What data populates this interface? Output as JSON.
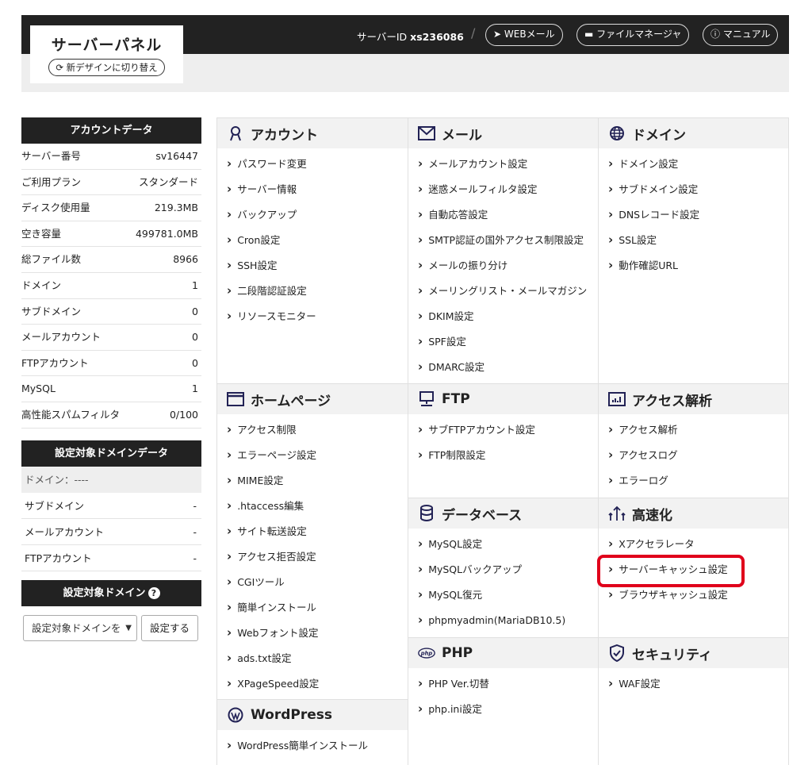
{
  "header": {
    "logo_title": "サーバーパネル",
    "redesign_label": "新デザインに切り替え",
    "server_id_label": "サーバーID",
    "server_id_value": "xs236086",
    "separator": "/",
    "buttons": {
      "webmail": "WEBメール",
      "file_manager": "ファイルマネージャ",
      "manual": "マニュアル"
    }
  },
  "account": {
    "title": "アカウントデータ",
    "rows": [
      {
        "label": "サーバー番号",
        "value": "sv16447"
      },
      {
        "label": "ご利用プラン",
        "value": "スタンダード"
      },
      {
        "label": "ディスク使用量",
        "value": "219.3MB"
      },
      {
        "label": "空き容量",
        "value": "499781.0MB"
      },
      {
        "label": "総ファイル数",
        "value": "8966"
      },
      {
        "label": "ドメイン",
        "value": "1"
      },
      {
        "label": "サブドメイン",
        "value": "0"
      },
      {
        "label": "メールアカウント",
        "value": "0"
      },
      {
        "label": "FTPアカウント",
        "value": "0"
      },
      {
        "label": "MySQL",
        "value": "1"
      },
      {
        "label": "高性能スパムフィルタ",
        "value": "0/100"
      }
    ]
  },
  "domain_data": {
    "title": "設定対象ドメインデータ",
    "domain_row": "ドメイン：----",
    "rows": [
      {
        "label": "サブドメイン",
        "value": "-"
      },
      {
        "label": "メールアカウント",
        "value": "-"
      },
      {
        "label": "FTPアカウント",
        "value": "-"
      }
    ]
  },
  "target_domain": {
    "title": "設定対象ドメイン",
    "select_value": "設定対象ドメインを",
    "apply_label": "設定する"
  },
  "sections": {
    "account": {
      "title": "アカウント",
      "links": [
        "パスワード変更",
        "サーバー情報",
        "バックアップ",
        "Cron設定",
        "SSH設定",
        "二段階認証設定",
        "リソースモニター"
      ]
    },
    "mail": {
      "title": "メール",
      "links": [
        "メールアカウント設定",
        "迷惑メールフィルタ設定",
        "自動応答設定",
        "SMTP認証の国外アクセス制限設定",
        "メールの振り分け",
        "メーリングリスト・メールマガジン",
        "DKIM設定",
        "SPF設定",
        "DMARC設定"
      ]
    },
    "domain": {
      "title": "ドメイン",
      "links": [
        "ドメイン設定",
        "サブドメイン設定",
        "DNSレコード設定",
        "SSL設定",
        "動作確認URL"
      ]
    },
    "homepage": {
      "title": "ホームページ",
      "links": [
        "アクセス制限",
        "エラーページ設定",
        "MIME設定",
        ".htaccess編集",
        "サイト転送設定",
        "アクセス拒否設定",
        "CGIツール",
        "簡単インストール",
        "Webフォント設定",
        "ads.txt設定",
        "XPageSpeed設定"
      ]
    },
    "ftp": {
      "title": "FTP",
      "links": [
        "サブFTPアカウント設定",
        "FTP制限設定"
      ]
    },
    "analytics": {
      "title": "アクセス解析",
      "links": [
        "アクセス解析",
        "アクセスログ",
        "エラーログ"
      ]
    },
    "database": {
      "title": "データベース",
      "links": [
        "MySQL設定",
        "MySQLバックアップ",
        "MySQL復元",
        "phpmyadmin(MariaDB10.5)"
      ]
    },
    "speed": {
      "title": "高速化",
      "links": [
        "Xアクセラレータ",
        "サーバーキャッシュ設定",
        "ブラウザキャッシュ設定"
      ]
    },
    "php": {
      "title": "PHP",
      "icon_text": "php",
      "links": [
        "PHP Ver.切替",
        "php.ini設定"
      ]
    },
    "security": {
      "title": "セキュリティ",
      "links": [
        "WAF設定"
      ]
    },
    "wordpress": {
      "title": "WordPress",
      "links": [
        "WordPress簡単インストール"
      ]
    }
  },
  "highlight_color": "#e0001b"
}
